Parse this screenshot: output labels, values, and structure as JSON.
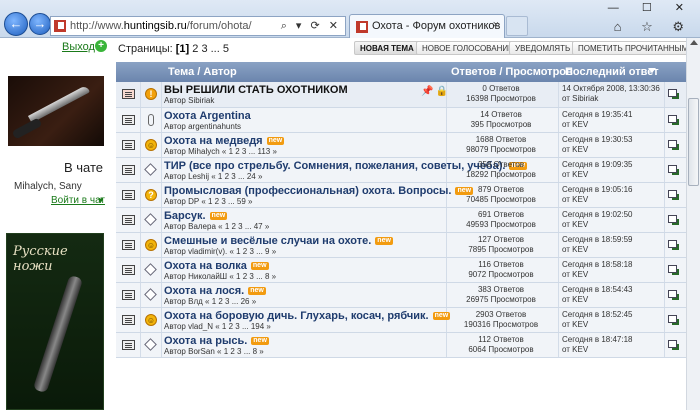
{
  "browser": {
    "url_prefix": "http://www.",
    "url_host": "huntingsib.ru",
    "url_path": "/forum/ohota/",
    "tab_title": "Охота - Форум охотников",
    "tab_close": "×",
    "address_tools": "⌕ ▾ ⟳ ✕",
    "window_controls": "— ☐ ✕",
    "toolbar_icons": "⌂ ☆ ⚙"
  },
  "left": {
    "logout_label": "Выход",
    "chat_title": "В чате",
    "chat_users": "Mihalych, Sany",
    "chat_link": "Войти в чат",
    "ad2_title": "Русские ножи"
  },
  "pager": {
    "label": "Страницы:",
    "current": "[1]",
    "others": "2 3 ... 5"
  },
  "toolbar": {
    "new_topic": "Новая тема",
    "new_poll": "Новое голосование",
    "notify": "Уведомлять",
    "mark_read": "Пометить прочитанными"
  },
  "table": {
    "col_topic": "Тема / Автор",
    "col_stats": "Ответов / Просмотров",
    "col_last": "Последний ответ"
  },
  "topics": [
    {
      "title": "ВЫ РЕШИЛИ СТАТЬ ОХОТНИКОМ",
      "author": "Автор Sibiriak",
      "pages": "",
      "new": "",
      "replies": "0 Ответов",
      "views": "16398 Просмотров",
      "last_date": "14 Октября 2008, 13:30:36",
      "last_by": "от Sibiriak",
      "status": "excl",
      "sticky": true
    },
    {
      "title": "Охота Argentina",
      "author": "Автор argentinahunts",
      "pages": "",
      "new": "",
      "replies": "14 Ответов",
      "views": "395 Просмотров",
      "last_date": "Сегодня в 19:35:41",
      "last_by": "от KEV",
      "status": "clip",
      "sticky": false
    },
    {
      "title": "Охота на медведя",
      "author": "Автор Mihalych",
      "pages": "« 1 2 3 ... 113 »",
      "new": "new",
      "replies": "1688 Ответов",
      "views": "98079 Просмотров",
      "last_date": "Сегодня в 19:30:53",
      "last_by": "от KEV",
      "status": "smile",
      "sticky": false
    },
    {
      "title": "ТИР (все про стрельбу. Сомнения, пожелания, советы, учеба).",
      "author": "Автор Leshij",
      "pages": "« 1 2 3 ... 24 »",
      "new": "new",
      "replies": "358 Ответов",
      "views": "18292 Просмотров",
      "last_date": "Сегодня в 19:09:35",
      "last_by": "от KEV",
      "status": "diamond",
      "sticky": false
    },
    {
      "title": "Промысловая (профессиональная) охота. Вопросы.",
      "author": "Автор DP",
      "pages": "« 1 2 3 ... 59 »",
      "new": "new",
      "replies": "879 Ответов",
      "views": "70485 Просмотров",
      "last_date": "Сегодня в 19:05:16",
      "last_by": "от KEV",
      "status": "quest",
      "sticky": false
    },
    {
      "title": "Барсук.",
      "author": "Автор Валера",
      "pages": "« 1 2 3 ... 47 »",
      "new": "new",
      "replies": "691 Ответов",
      "views": "49593 Просмотров",
      "last_date": "Сегодня в 19:02:50",
      "last_by": "от KEV",
      "status": "diamond",
      "sticky": false
    },
    {
      "title": "Смешные и весёлые случаи на охоте.",
      "author": "Автор vladimir(v).",
      "pages": "« 1 2 3 ... 9 »",
      "new": "new",
      "replies": "127 Ответов",
      "views": "7895 Просмотров",
      "last_date": "Сегодня в 18:59:59",
      "last_by": "от KEV",
      "status": "smile",
      "sticky": false
    },
    {
      "title": "Охота на волка",
      "author": "Автор НиколайШ",
      "pages": "« 1 2 3 ... 8 »",
      "new": "new",
      "replies": "116 Ответов",
      "views": "9072 Просмотров",
      "last_date": "Сегодня в 18:58:18",
      "last_by": "от KEV",
      "status": "diamond",
      "sticky": false
    },
    {
      "title": "Охота на лося.",
      "author": "Автор Влд",
      "pages": "« 1 2 3 ... 26 »",
      "new": "new",
      "replies": "383 Ответов",
      "views": "26975 Просмотров",
      "last_date": "Сегодня в 18:54:43",
      "last_by": "от KEV",
      "status": "diamond",
      "sticky": false
    },
    {
      "title": "Охота на боровую дичь. Глухарь, косач, рябчик.",
      "author": "Автор vlad_N",
      "pages": "« 1 2 3 ... 194 »",
      "new": "new",
      "replies": "2903 Ответов",
      "views": "190316 Просмотров",
      "last_date": "Сегодня в 18:52:45",
      "last_by": "от KEV",
      "status": "smile",
      "sticky": false
    },
    {
      "title": "Охота на рысь.",
      "author": "Автор BorSan",
      "pages": "« 1 2 3 ... 8 »",
      "new": "new",
      "replies": "112 Ответов",
      "views": "6064 Просмотров",
      "last_date": "Сегодня в 18:47:18",
      "last_by": "от KEV",
      "status": "diamond",
      "sticky": false
    }
  ]
}
